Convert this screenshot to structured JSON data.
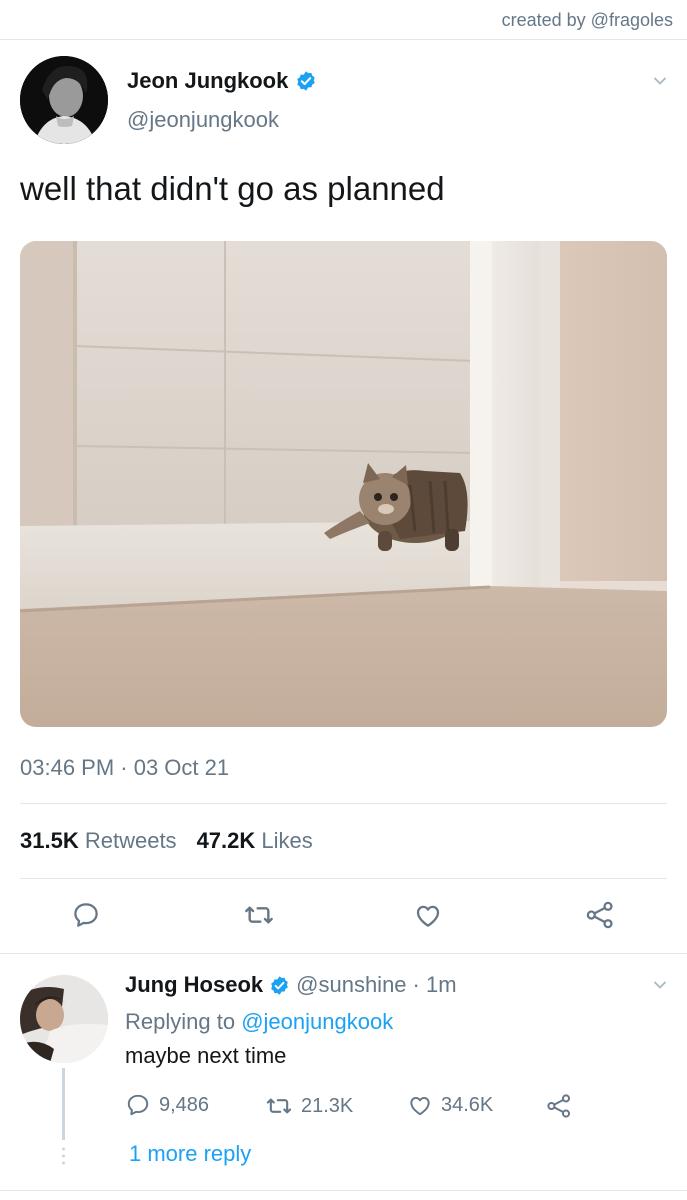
{
  "credit": "created by @fragoles",
  "tweet": {
    "name": "Jeon Jungkook",
    "handle": "@jeonjungkook",
    "text": "well that didn't go as planned",
    "timestamp": "03:46 PM · 03 Oct 21",
    "retweets_count": "31.5K",
    "retweets_label": "Retweets",
    "likes_count": "47.2K",
    "likes_label": "Likes"
  },
  "reply": {
    "name": "Jung Hoseok",
    "handle": "@sunshine",
    "time": "· 1m",
    "replying_prefix": "Replying to",
    "replying_to": "@jeonjungkook",
    "text": "maybe next time",
    "replies": "9,486",
    "retweets": "21.3K",
    "likes": "34.6K",
    "more_replies": "1 more reply"
  },
  "colors": {
    "accent": "#1da1f2",
    "muted": "#657786",
    "text": "#14171a",
    "divider": "#e1e8ed"
  },
  "icons": [
    "verified-badge-icon",
    "chevron-down-icon",
    "comment-icon",
    "retweet-icon",
    "heart-icon",
    "share-icon"
  ]
}
